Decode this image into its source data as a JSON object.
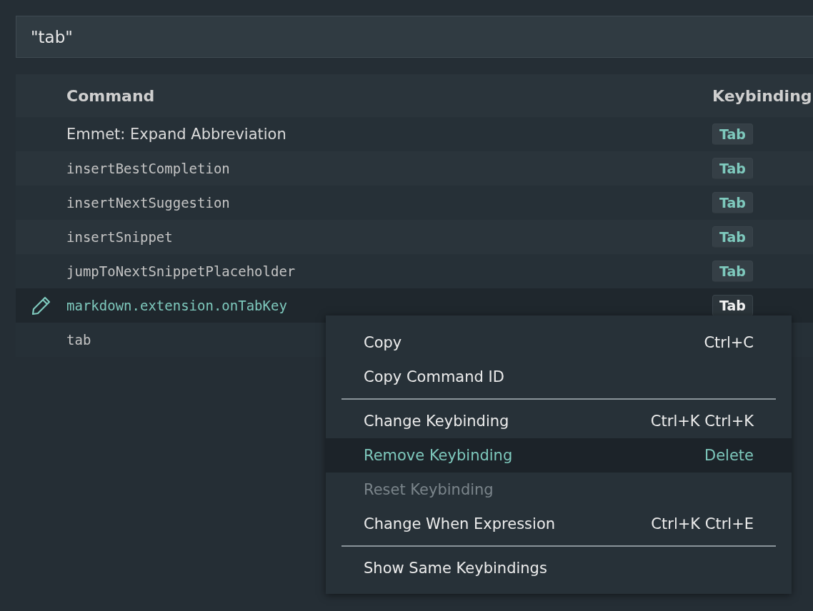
{
  "search": {
    "value": "\"tab\""
  },
  "table": {
    "columns": [
      "Command",
      "Keybinding"
    ],
    "rows": [
      {
        "kind": "label",
        "command": "Emmet: Expand Abbreviation",
        "keybinding": "Tab",
        "selected": false
      },
      {
        "kind": "id",
        "command": "insertBestCompletion",
        "keybinding": "Tab",
        "selected": false
      },
      {
        "kind": "id",
        "command": "insertNextSuggestion",
        "keybinding": "Tab",
        "selected": false
      },
      {
        "kind": "id",
        "command": "insertSnippet",
        "keybinding": "Tab",
        "selected": false
      },
      {
        "kind": "id",
        "command": "jumpToNextSnippetPlaceholder",
        "keybinding": "Tab",
        "selected": false
      },
      {
        "kind": "id",
        "command": "markdown.extension.onTabKey",
        "keybinding": "Tab",
        "selected": true
      },
      {
        "kind": "id",
        "command": "tab",
        "selected": false
      }
    ]
  },
  "context_menu": {
    "items": [
      {
        "kind": "item",
        "label": "Copy",
        "shortcut": "Ctrl+C",
        "selected": false,
        "disabled": false
      },
      {
        "kind": "item",
        "label": "Copy Command ID",
        "selected": false,
        "disabled": false
      },
      {
        "kind": "separator"
      },
      {
        "kind": "item",
        "label": "Change Keybinding",
        "shortcut": "Ctrl+K Ctrl+K",
        "selected": false,
        "disabled": false
      },
      {
        "kind": "item",
        "label": "Remove Keybinding",
        "shortcut": "Delete",
        "selected": true,
        "disabled": false
      },
      {
        "kind": "item",
        "label": "Reset Keybinding",
        "selected": false,
        "disabled": true
      },
      {
        "kind": "item",
        "label": "Change When Expression",
        "shortcut": "Ctrl+K Ctrl+E",
        "selected": false,
        "disabled": false
      },
      {
        "kind": "separator"
      },
      {
        "kind": "item",
        "label": "Show Same Keybindings",
        "selected": false,
        "disabled": false
      }
    ]
  }
}
